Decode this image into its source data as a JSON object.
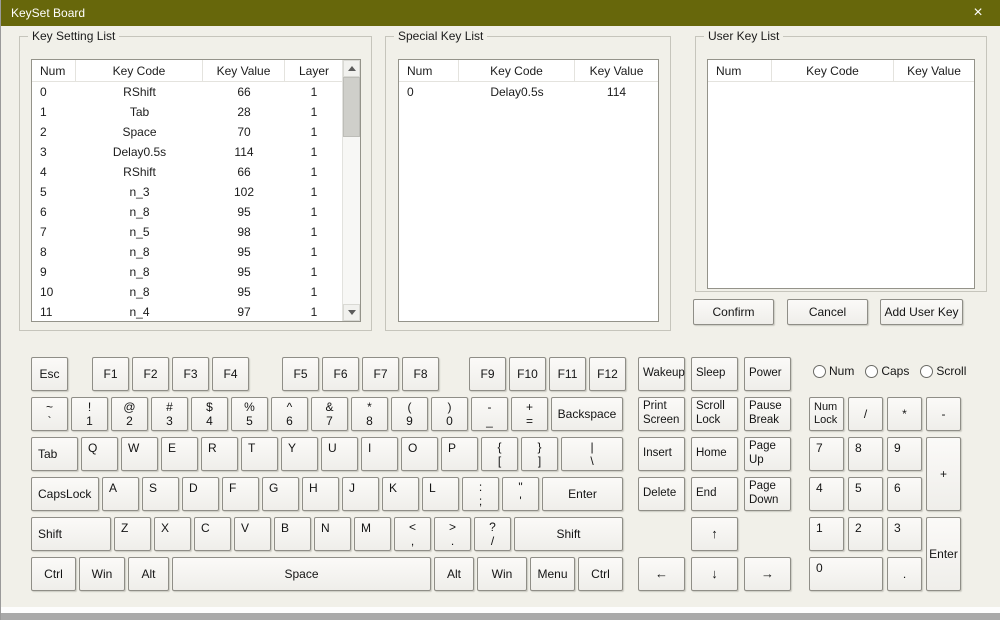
{
  "window": {
    "title": "KeySet Board",
    "close_glyph": "×"
  },
  "panels": {
    "key_setting": {
      "title": "Key Setting List",
      "columns": [
        "Num",
        "Key Code",
        "Key Value",
        "Layer"
      ],
      "rows": [
        [
          "0",
          "RShift",
          "66",
          "1"
        ],
        [
          "1",
          "Tab",
          "28",
          "1"
        ],
        [
          "2",
          "Space",
          "70",
          "1"
        ],
        [
          "3",
          "Delay0.5s",
          "114",
          "1"
        ],
        [
          "4",
          "RShift",
          "66",
          "1"
        ],
        [
          "5",
          "n_3",
          "102",
          "1"
        ],
        [
          "6",
          "n_8",
          "95",
          "1"
        ],
        [
          "7",
          "n_5",
          "98",
          "1"
        ],
        [
          "8",
          "n_8",
          "95",
          "1"
        ],
        [
          "9",
          "n_8",
          "95",
          "1"
        ],
        [
          "10",
          "n_8",
          "95",
          "1"
        ],
        [
          "11",
          "n_4",
          "97",
          "1"
        ]
      ]
    },
    "special_key": {
      "title": "Special Key List",
      "columns": [
        "Num",
        "Key Code",
        "Key Value"
      ],
      "rows": [
        [
          "0",
          "Delay0.5s",
          "114"
        ]
      ]
    },
    "user_key": {
      "title": "User Key List",
      "columns": [
        "Num",
        "Key Code",
        "Key Value"
      ],
      "rows": []
    }
  },
  "buttons": {
    "confirm": "Confirm",
    "cancel": "Cancel",
    "add_user_key": "Add User Key"
  },
  "indicators": {
    "num": "Num",
    "caps": "Caps",
    "scroll": "Scroll"
  },
  "kb": {
    "r1": [
      "Esc",
      "F1",
      "F2",
      "F3",
      "F4",
      "F5",
      "F6",
      "F7",
      "F8",
      "F9",
      "F10",
      "F11",
      "F12"
    ],
    "r2": [
      "~\n`",
      "!\n1",
      "@\n2",
      "#\n3",
      "$\n4",
      "%\n5",
      "^\n6",
      "&\n7",
      "*\n8",
      "(\n9",
      ")\n0",
      "-\n_",
      "+\n=",
      "Backspace"
    ],
    "r3": [
      "Tab",
      "Q",
      "W",
      "E",
      "R",
      "T",
      "Y",
      "U",
      "I",
      "O",
      "P",
      "{\n[",
      "}\n]",
      "|\n\\"
    ],
    "r4": [
      "CapsLock",
      "A",
      "S",
      "D",
      "F",
      "G",
      "H",
      "J",
      "K",
      "L",
      ":\n;",
      "\"\n'",
      "Enter"
    ],
    "r5": [
      "Shift",
      "Z",
      "X",
      "C",
      "V",
      "B",
      "N",
      "M",
      "<\n,",
      ">\n.",
      "?\n/",
      "Shift"
    ],
    "r6": [
      "Ctrl",
      "Win",
      "Alt",
      "Space",
      "Alt",
      "Win",
      "Menu",
      "Ctrl"
    ],
    "mid": [
      "Wakeup",
      "Sleep",
      "Power",
      "Print\nScreen",
      "Scroll\nLock",
      "Pause\nBreak",
      "Insert",
      "Home",
      "Page\nUp",
      "Delete",
      "End",
      "Page\nDown",
      "↑",
      "←",
      "↓",
      "→"
    ],
    "np": [
      "Num\nLock",
      "/",
      "*",
      "-",
      "7",
      "8",
      "9",
      "+",
      "4",
      "5",
      "6",
      "1",
      "2",
      "3",
      "Enter",
      "0",
      "."
    ]
  }
}
